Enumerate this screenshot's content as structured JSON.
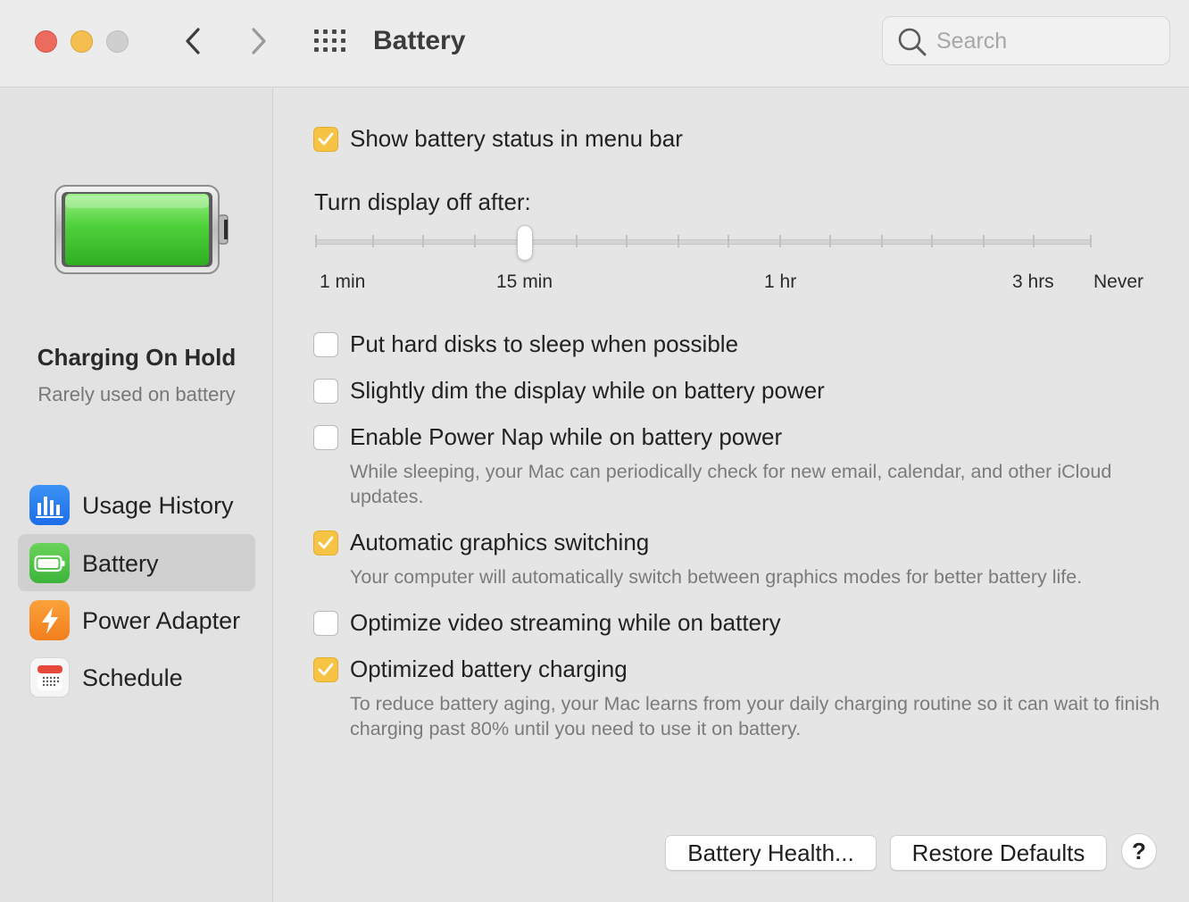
{
  "window": {
    "title": "Battery",
    "search_placeholder": "Search"
  },
  "sidebar": {
    "status_title": "Charging On Hold",
    "status_subtitle": "Rarely used on battery",
    "battery_level": 1.0,
    "items": [
      {
        "label": "Usage History",
        "icon": "chart-bars-icon",
        "selected": false
      },
      {
        "label": "Battery",
        "icon": "battery-icon",
        "selected": true
      },
      {
        "label": "Power Adapter",
        "icon": "lightning-icon",
        "selected": false
      },
      {
        "label": "Schedule",
        "icon": "calendar-icon",
        "selected": false
      }
    ]
  },
  "main": {
    "show_status": {
      "label": "Show battery status in menu bar",
      "checked": true
    },
    "display_off": {
      "title": "Turn display off after:",
      "labels": [
        "1 min",
        "15 min",
        "1 hr",
        "3 hrs",
        "Never"
      ],
      "value_label": "15 min",
      "tick_count": 16,
      "value_index": 4
    },
    "options": [
      {
        "label": "Put hard disks to sleep when possible",
        "checked": false,
        "description": ""
      },
      {
        "label": "Slightly dim the display while on battery power",
        "checked": false,
        "description": ""
      },
      {
        "label": "Enable Power Nap while on battery power",
        "checked": false,
        "description": "While sleeping, your Mac can periodically check for new email, calendar, and other iCloud updates."
      },
      {
        "label": "Automatic graphics switching",
        "checked": true,
        "description": "Your computer will automatically switch between graphics modes for better battery life."
      },
      {
        "label": "Optimize video streaming while on battery",
        "checked": false,
        "description": ""
      },
      {
        "label": "Optimized battery charging",
        "checked": true,
        "description": "To reduce battery aging, your Mac learns from your daily charging routine so it can wait to finish charging past 80% until you need to use it on battery."
      }
    ],
    "buttons": {
      "battery_health": "Battery Health...",
      "restore_defaults": "Restore Defaults",
      "help": "?"
    }
  },
  "colors": {
    "checkbox_accent": "#f6c344",
    "traffic_close": "#ed6a5e",
    "traffic_minimize": "#f5bf4f",
    "battery_fill": "#4fd13a"
  }
}
